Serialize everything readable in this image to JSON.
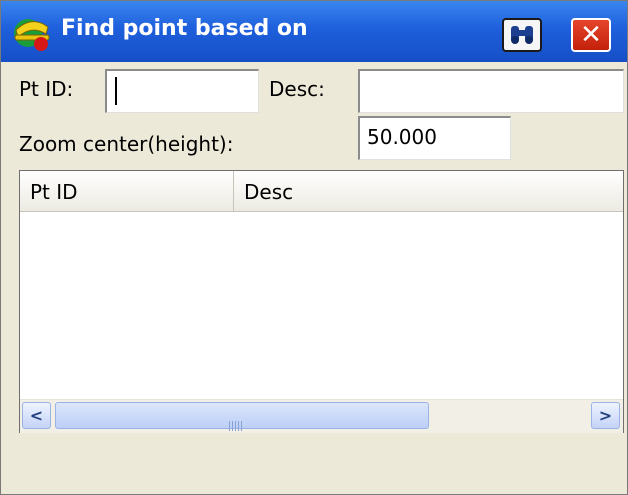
{
  "window": {
    "title": "Find point based on",
    "title_icon": "surveyor-hardhat-icon",
    "find_icon": "binoculars-icon",
    "close_icon": "close-icon",
    "close_glyph": "✕"
  },
  "form": {
    "pt_id_label": "Pt ID:",
    "pt_id_value": "",
    "desc_label": "Desc:",
    "desc_value": "",
    "zoom_label": "Zoom center(height):",
    "zoom_value": "50.000"
  },
  "list": {
    "columns": [
      "Pt ID",
      "Desc"
    ],
    "rows": []
  },
  "scrollbar": {
    "left_arrow": "<",
    "right_arrow": ">"
  },
  "colors": {
    "title_bar": "#1e5fdc",
    "close_button": "#d4331a",
    "dialog_bg": "#ece9d8"
  }
}
